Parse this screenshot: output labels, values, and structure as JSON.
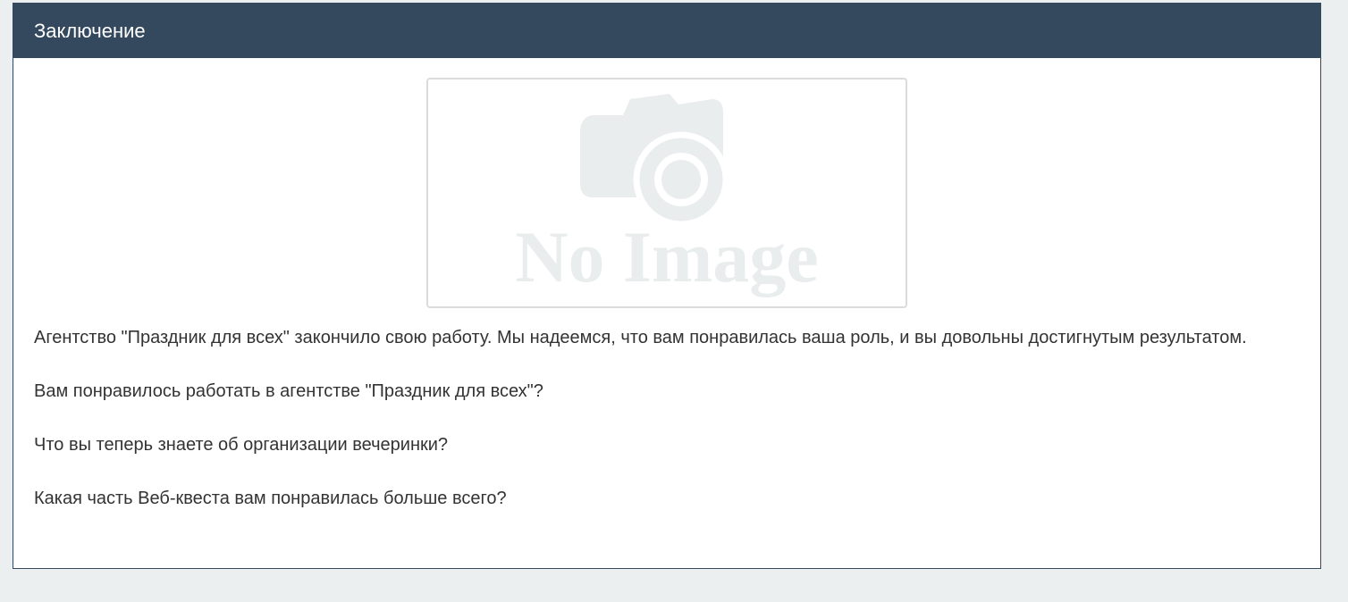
{
  "panel": {
    "title": "Заключение"
  },
  "image": {
    "alt": "No Image",
    "icon": "camera-icon"
  },
  "paragraphs": [
    "Агентство \"Праздник для всех\"  закончило свою работу. Мы надеемся, что вам понравилась ваша роль, и вы довольны достигнутым результатом.",
    "Вам понравилось работать в агентстве \"Праздник для всех\"?",
    "Что вы теперь знаете об организации вечеринки?",
    "Какая часть Веб-квеста вам понравилась больше всего?"
  ],
  "colors": {
    "header": "#34495e",
    "page_bg": "#ebeff0",
    "text": "#333333",
    "placeholder": "#e9edee"
  }
}
